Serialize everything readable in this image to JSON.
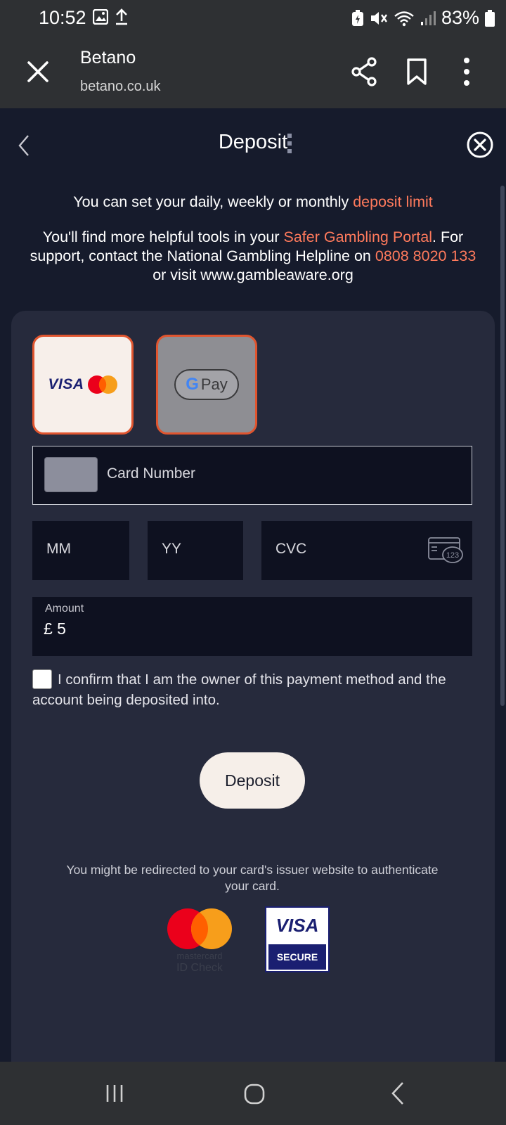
{
  "status_bar": {
    "time": "10:52",
    "battery": "83%",
    "icons": [
      "gallery-icon",
      "upload-icon",
      "battery-saver-icon",
      "mute-icon",
      "wifi-icon",
      "signal-icon",
      "battery-icon"
    ]
  },
  "browser": {
    "title": "Betano",
    "url": "betano.co.uk",
    "icons": [
      "close-icon",
      "share-icon",
      "bookmark-icon",
      "more-vertical-icon"
    ]
  },
  "header": {
    "title": "Deposit"
  },
  "info": {
    "line1_prefix": "You can set your daily, weekly or monthly ",
    "line1_link": "deposit limit",
    "line2_prefix": "You'll find more helpful tools in your ",
    "line2_link": "Safer Gambling Portal",
    "line2_mid": ". For support, contact the National Gambling Helpline on ",
    "line2_phone": "0808 8020 133",
    "line2_suffix": " or visit www.gambleaware.org"
  },
  "payment_methods": {
    "card_label": "VISA",
    "gpay_g": "G",
    "gpay_label": "Pay",
    "selected": "card"
  },
  "form": {
    "card_number_label": "Card Number",
    "mm_label": "MM",
    "yy_label": "YY",
    "cvc_label": "CVC",
    "cvc_icon_text": "123",
    "amount_label": "Amount",
    "amount_value": "£ 5",
    "confirm_text": "I confirm that I am the owner of this payment method and the account being deposited into.",
    "confirm_checked": false,
    "deposit_button": "Deposit"
  },
  "footer": {
    "redirect_note": "You might be redirected to your card's issuer website to authenticate your card.",
    "mastercard_line1": "mastercard",
    "mastercard_line2": "ID Check",
    "visa_secure_top": "VISA",
    "visa_secure_bottom": "SECURE"
  },
  "colors": {
    "background": "#161b2c",
    "panel": "#262a3c",
    "accent": "#ff7a5c",
    "tile_border": "#e0552f",
    "system_bar": "#2e3033"
  }
}
